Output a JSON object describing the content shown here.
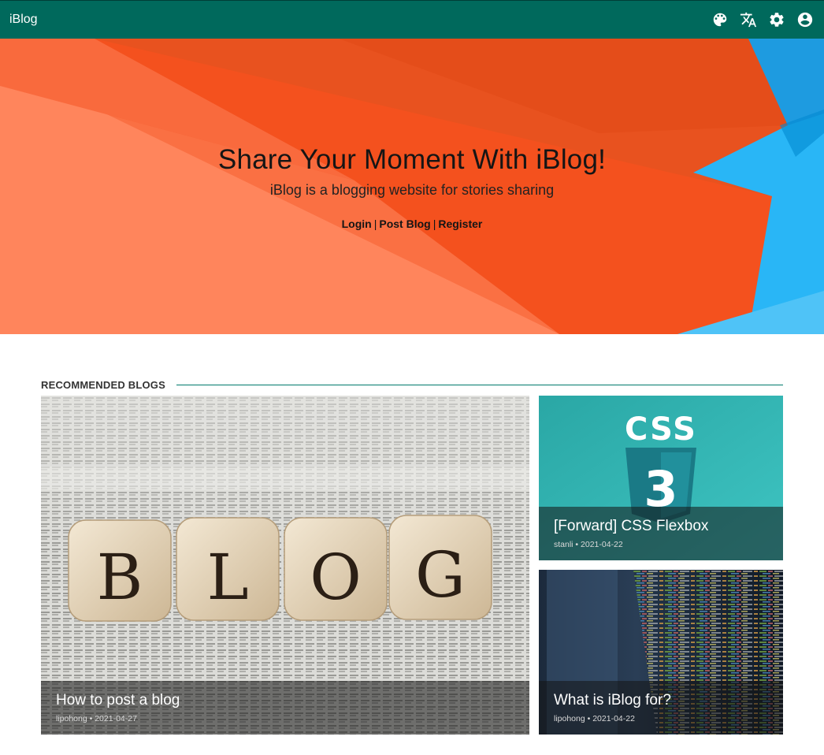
{
  "appbar": {
    "title": "iBlog",
    "icons": [
      "palette-icon",
      "translate-icon",
      "settings-icon",
      "account-icon"
    ]
  },
  "hero": {
    "title": "Share Your Moment With iBlog!",
    "subtitle": "iBlog is a blogging website for stories sharing",
    "links": {
      "login": "Login",
      "post": "Post Blog",
      "register": "Register",
      "separator": "|"
    }
  },
  "section": {
    "title": "RECOMMENDED BLOGS"
  },
  "cards": [
    {
      "title": "How to post a blog",
      "author": "lipohong",
      "date": "2021-04-27",
      "image_letters": [
        "B",
        "L",
        "O",
        "G"
      ]
    },
    {
      "title": "[Forward] CSS Flexbox",
      "author": "stanli",
      "date": "2021-04-22",
      "image_text": "CSS",
      "image_number": "3"
    },
    {
      "title": "What is iBlog for?",
      "author": "lipohong",
      "date": "2021-04-22"
    }
  ],
  "meta_sep": " • ",
  "colors": {
    "appbar": "#00695c",
    "hero_orange": "#f4511e",
    "hero_blue": "#29b6f6",
    "accent": "#00796b"
  }
}
